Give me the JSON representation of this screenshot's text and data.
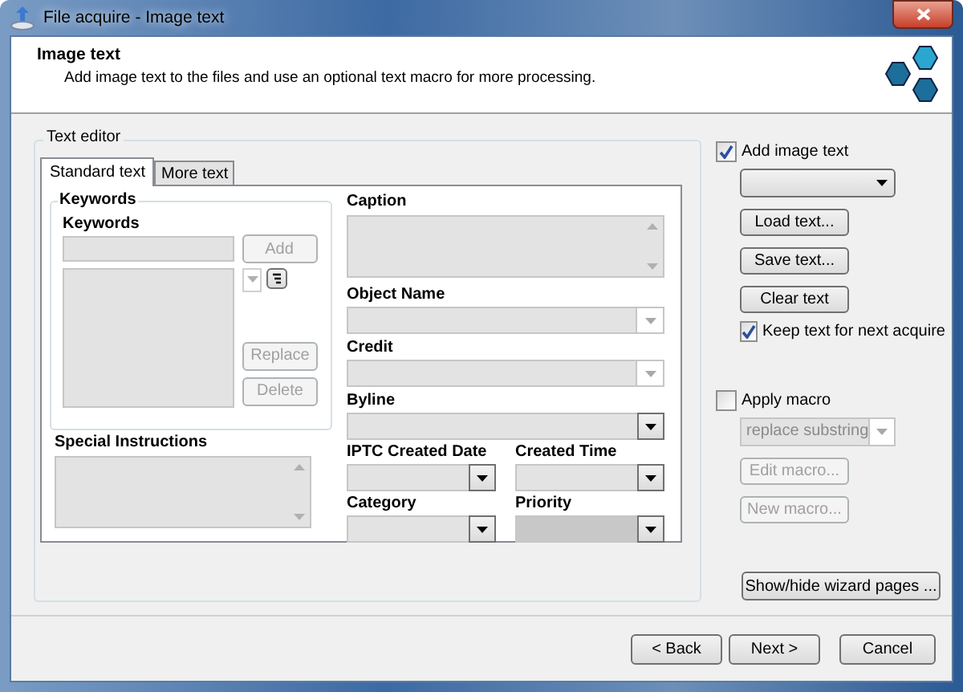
{
  "window": {
    "title": "File acquire - Image text"
  },
  "header": {
    "title": "Image text",
    "subtitle": "Add image text to the files and use an optional text macro for more processing."
  },
  "text_editor": {
    "label": "Text editor",
    "tabs": [
      {
        "label": "Standard text",
        "selected": true
      },
      {
        "label": "More text",
        "selected": false
      }
    ],
    "keywords": {
      "group_label": "Keywords",
      "field_label": "Keywords",
      "buttons": [
        {
          "label": "Add",
          "disabled": true
        },
        {
          "label": "Replace",
          "disabled": true
        },
        {
          "label": "Delete",
          "disabled": true
        }
      ]
    },
    "special_instructions": {
      "label": "Special Instructions"
    },
    "caption": {
      "label": "Caption"
    },
    "combos": [
      {
        "label": "Object Name",
        "disabled": true
      },
      {
        "label": "Credit",
        "disabled": true
      },
      {
        "label": "Byline",
        "disabled": false
      }
    ],
    "small_combos": [
      {
        "label": "IPTC Created Date",
        "disabled": false
      },
      {
        "label": "Created Time",
        "disabled": false
      },
      {
        "label": "Category",
        "disabled": false
      },
      {
        "label": "Priority",
        "disabled": false
      }
    ]
  },
  "image_text": {
    "checkbox": {
      "label": "Add image text",
      "checked": true
    },
    "controls": [
      {
        "kind": "combo",
        "disabled": false
      },
      {
        "kind": "button",
        "label": "Load text...",
        "disabled": false
      },
      {
        "kind": "button",
        "label": "Save text...",
        "disabled": false
      },
      {
        "kind": "button",
        "label": "Clear text",
        "disabled": false
      },
      {
        "kind": "checkbox",
        "label": "Keep text for next acquire",
        "checked": true
      }
    ]
  },
  "macro": {
    "checkbox": {
      "label": "Apply macro",
      "checked": false
    },
    "controls": [
      {
        "kind": "combo",
        "value": "replace substring",
        "disabled": true
      },
      {
        "kind": "button",
        "label": "Edit macro...",
        "disabled": true
      },
      {
        "kind": "button",
        "label": "New macro...",
        "disabled": true
      }
    ]
  },
  "wizard_button": {
    "label": "Show/hide wizard pages ..."
  },
  "footer": {
    "buttons": [
      {
        "label": "< Back"
      },
      {
        "label": "Next >"
      },
      {
        "label": "Cancel"
      }
    ]
  }
}
